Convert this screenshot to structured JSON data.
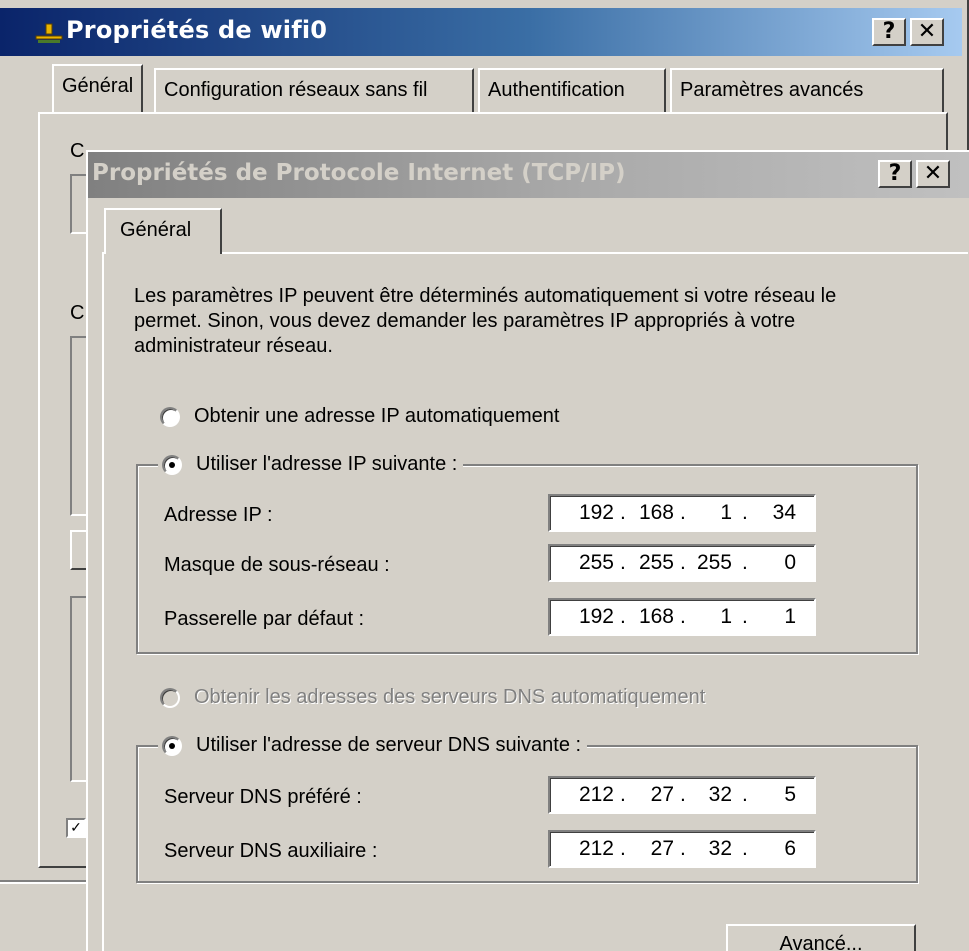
{
  "back_window": {
    "title": "Propriétés de wifi0",
    "help_button": "?",
    "close_button": "✕",
    "tabs": [
      {
        "label": "Général"
      },
      {
        "label": "Configuration réseaux sans fil"
      },
      {
        "label": "Authentification"
      },
      {
        "label": "Paramètres avancés"
      }
    ],
    "partial_letter_1": "C",
    "partial_letter_2": "C",
    "check_mark": "✓"
  },
  "dialog": {
    "title": "Propriétés de Protocole Internet (TCP/IP)",
    "help_button": "?",
    "close_button": "✕",
    "tab_label": "Général",
    "intro_text": "Les paramètres IP peuvent être déterminés automatiquement si votre réseau le permet. Sinon, vous devez demander les paramètres IP appropriés à votre administrateur réseau.",
    "ip_auto_radio": {
      "label": "Obtenir une adresse IP automatiquement",
      "checked": false
    },
    "ip_manual_radio": {
      "label": "Utiliser l'adresse IP suivante :",
      "checked": true
    },
    "ip_fields": [
      {
        "label": "Adresse IP :",
        "octets": [
          "192",
          "168",
          "1",
          "34"
        ]
      },
      {
        "label": "Masque de sous-réseau :",
        "octets": [
          "255",
          "255",
          "255",
          "0"
        ]
      },
      {
        "label": "Passerelle par défaut :",
        "octets": [
          "192",
          "168",
          "1",
          "1"
        ]
      }
    ],
    "dns_auto_radio": {
      "label": "Obtenir les adresses des serveurs DNS automatiquement",
      "checked": false,
      "disabled": true
    },
    "dns_manual_radio": {
      "label": "Utiliser l'adresse de serveur DNS suivante :",
      "checked": true
    },
    "dns_fields": [
      {
        "label": "Serveur DNS préféré :",
        "octets": [
          "212",
          "27",
          "32",
          "5"
        ]
      },
      {
        "label": "Serveur DNS auxiliaire :",
        "octets": [
          "212",
          "27",
          "32",
          "6"
        ]
      }
    ],
    "advanced_button": "Avancé..."
  },
  "colors": {
    "face": "#d4d0c8",
    "active_title_start": "#0a246a",
    "active_title_end": "#a6caf0",
    "inactive_title_start": "#808080",
    "inactive_title_end": "#c0c0c0"
  }
}
